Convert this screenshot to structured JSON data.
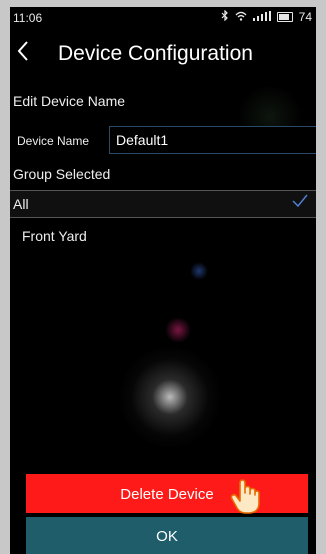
{
  "status_bar": {
    "time": "11:06",
    "bluetooth_icon": "bluetooth-icon",
    "wifi_icon": "wifi-icon",
    "signal_icon": "signal-icon",
    "battery_icon": "battery-icon",
    "battery_level": "74"
  },
  "header": {
    "back_icon": "chevron-left-icon",
    "title": "Device Configuration"
  },
  "edit_section": {
    "heading": "Edit Device Name",
    "name_label": "Device Name",
    "name_value": "Default1"
  },
  "group_section": {
    "heading": "Group Selected",
    "items": [
      {
        "label": "All",
        "selected": true
      },
      {
        "label": "Front Yard",
        "selected": false
      }
    ],
    "check_icon": "checkmark-icon"
  },
  "actions": {
    "delete_label": "Delete Device",
    "ok_label": "OK",
    "delete_color": "#ff1a1a",
    "ok_color": "#1f5d6b",
    "pointer_icon": "hand-pointer-icon"
  }
}
